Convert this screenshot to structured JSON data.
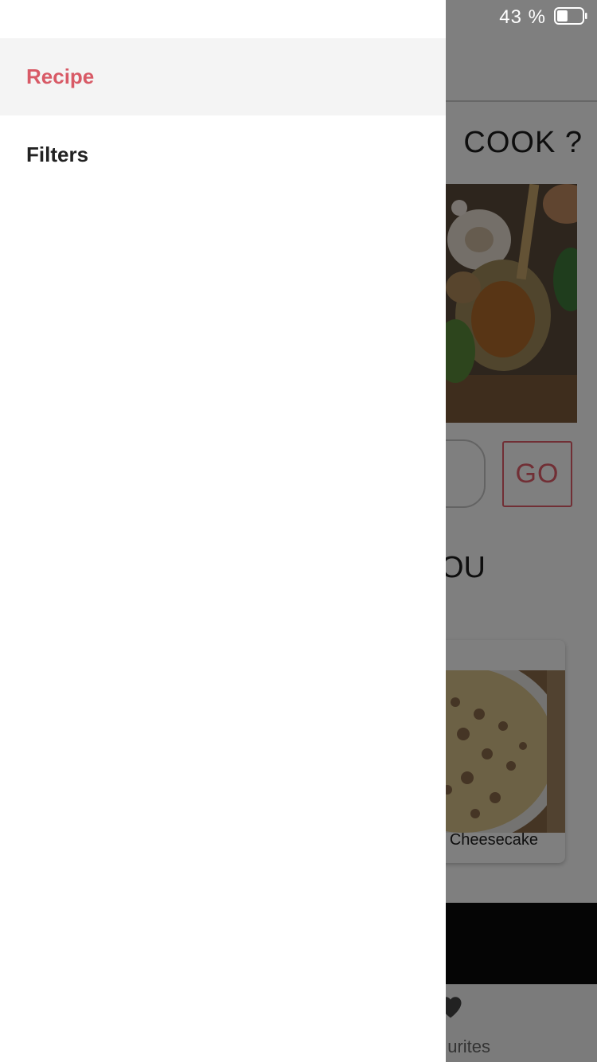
{
  "status_bar": {
    "battery_percent_text": "43 %",
    "battery_level": 0.43
  },
  "drawer": {
    "items": [
      {
        "label": "Recipe",
        "active": true
      },
      {
        "label": "Filters",
        "active": false
      }
    ]
  },
  "background_screen": {
    "question_text": "COOK ?",
    "go_button_label": "GO",
    "section_title": "OU",
    "card_title": "t Cheesecake",
    "favourites_tab_label": "urites"
  },
  "colors": {
    "accent": "#d85a66",
    "go_accent": "#e25f6b",
    "drawer_active_bg": "#f4f4f4",
    "overlay": "rgba(0,0,0,0.5)"
  },
  "icons": {
    "battery": "battery-icon",
    "favourites": "heart-icon"
  }
}
